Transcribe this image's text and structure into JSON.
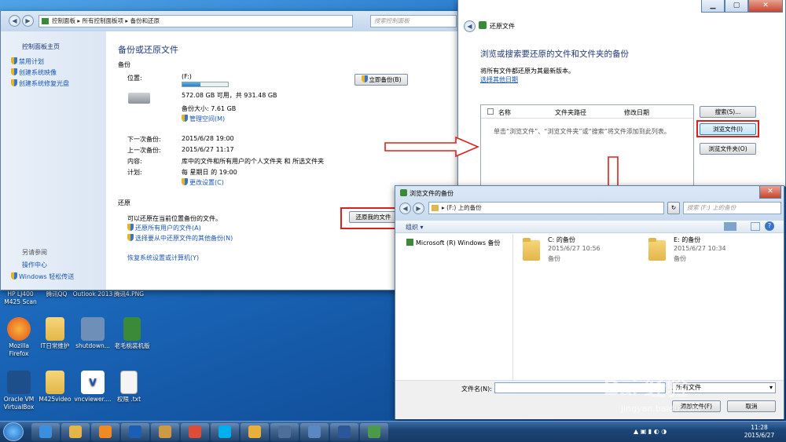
{
  "desktop": {
    "icons": [
      {
        "id": "hp",
        "label": "HP LJ400 M425 Scan",
        "color": "#3a70c0"
      },
      {
        "id": "qq",
        "label": "腾讯QQ",
        "color": "#222"
      },
      {
        "id": "outlook",
        "label": "Outlook 2013",
        "color": "#1a5fb4"
      },
      {
        "id": "png",
        "label": "腾讯4.PNG",
        "color": "#ccc"
      },
      {
        "id": "firefox",
        "label": "Mozilla Firefox",
        "color": "#e66a1f"
      },
      {
        "id": "it",
        "label": "IT日常维护",
        "color": "#e2b64a"
      },
      {
        "id": "shutdown",
        "label": "shutdown...",
        "color": "#6d8fb8"
      },
      {
        "id": "laomao",
        "label": "老毛桃装机版",
        "color": "#3a8a3a"
      },
      {
        "id": "vbox",
        "label": "Oracle VM VirtualBox",
        "color": "#1d4f8a"
      },
      {
        "id": "m425",
        "label": "M425video",
        "color": "#e2b64a"
      },
      {
        "id": "vnc",
        "label": "vncviewer....",
        "color": "#e0e0e0"
      },
      {
        "id": "perm",
        "label": "权限 .txt",
        "color": "#f4f4f4"
      }
    ]
  },
  "backup_window": {
    "address": {
      "crumbs": [
        "控制面板",
        "所有控制面板项",
        "备份和还原"
      ],
      "search_placeholder": "搜索控制面板"
    },
    "sidebar": {
      "home": "控制面板主页",
      "links": [
        "禁用计划",
        "创建系统映像",
        "创建系统修复光盘"
      ],
      "see_also": "另请参阅",
      "see_links": [
        "操作中心",
        "Windows 轻松传送"
      ]
    },
    "title": "备份或还原文件",
    "backup_section": "备份",
    "location_label": "位置:",
    "location_value": "(F:)",
    "disk_free": "572.08 GB 可用，共 931.48 GB",
    "disk_used_fraction": 0.39,
    "backup_size": "备份大小: 7.61 GB",
    "manage_space": "管理空间(M)",
    "backup_now": "立即备份(B)",
    "rows": [
      {
        "label": "下一次备份:",
        "value": "2015/6/28 19:00"
      },
      {
        "label": "上一次备份:",
        "value": "2015/6/27 11:17"
      },
      {
        "label": "内容:",
        "value": "库中的文件和所有用户的个人文件夹 和 所选文件夹"
      },
      {
        "label": "计划:",
        "value": "每 星期日 的 19:00"
      }
    ],
    "change_settings": "更改设置(C)",
    "restore_section": "还原",
    "restore_text": "可以还原在当前位置备份的文件。",
    "restore_all_users": "还原所有用户的文件(A)",
    "select_other": "选择要从中还原文件的其他备份(N)",
    "recover_settings": "恢复系统设置或计算机(Y)",
    "restore_my_files": "还原我的文件"
  },
  "restore_window": {
    "title": "还原文件",
    "heading": "浏览或搜索要还原的文件和文件夹的备份",
    "subtext": "将所有文件都还原为其最新版本。",
    "choose_date": "选择其他日期",
    "columns": [
      "名称",
      "文件夹路径",
      "修改日期"
    ],
    "empty_hint": "单击“浏览文件”、“浏览文件夹”或“搜索”将文件添加到此列表。",
    "search_btn": "搜索(S)...",
    "browse_files_btn": "浏览文件(I)",
    "browse_folders_btn": "浏览文件夹(O)"
  },
  "browse_dialog": {
    "title": "浏览文件的备份",
    "address": "(F:) 上的备份",
    "search_placeholder": "搜索 (F:) 上的备份",
    "organize": "组织 ▾",
    "nav_item": "Microsoft (R) Windows 备份",
    "items": [
      {
        "name": "C: 的备份",
        "date": "2015/6/27 10:56",
        "type": "备份"
      },
      {
        "name": "E: 的备份",
        "date": "2015/6/27 10:34",
        "type": "备份"
      }
    ],
    "filename_label": "文件名(N):",
    "filter_value": "所有文件",
    "add_files": "添加文件(F)",
    "cancel": "取消"
  },
  "taskbar": {
    "apps": [
      "ie",
      "explorer",
      "media",
      "outlook",
      "tool",
      "chrome",
      "skype",
      "vmware",
      "vbox",
      "rdp",
      "word",
      "network"
    ],
    "time": "11:28",
    "date": "2015/6/27"
  },
  "watermark": {
    "brand": "Bai 经验",
    "url": "jingyan.baidu.com"
  }
}
